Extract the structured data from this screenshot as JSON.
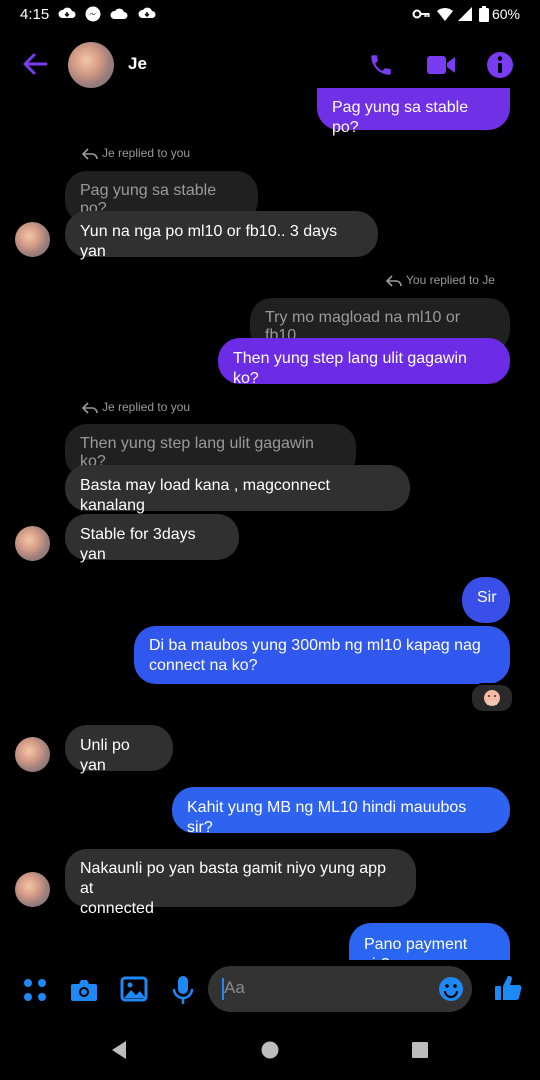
{
  "status_bar": {
    "time": "4:15",
    "battery": "60%"
  },
  "header": {
    "contact_name": "Je"
  },
  "messages": {
    "m1": "Pag yung sa stable po?",
    "reply1_label": "Je replied to you",
    "reply1_quote": "Pag yung sa stable po?",
    "m2": "Yun na nga po ml10 or fb10.. 3 days yan",
    "reply2_label": "You replied to Je",
    "reply2_quote": "Try mo magload na ml10 or fb10",
    "m3": "Then yung step lang ulit gagawin ko?",
    "reply3_label": "Je replied to you",
    "reply3_quote": "Then yung step lang ulit gagawin ko?",
    "m4": "Basta may load kana , magconnect kanalang",
    "m5": "Stable for 3days yan",
    "m6": "Sir",
    "m7_line1": "Di ba maubos yung 300mb ng ml10 kapag nag",
    "m7_line2": "connect na ko?",
    "m8": "Unli po yan",
    "m9": "Kahit yung MB ng ML10 hindi mauubos sir?",
    "m10_line1": "Nakaunli po yan basta gamit niyo yung app at",
    "m10_line2": "connected",
    "m11": "Pano payment sir?"
  },
  "compose": {
    "placeholder": "Aa"
  },
  "colors": {
    "accent": "#7a3cf0",
    "sent_purple": "#6c2ce6",
    "sent_blue": "#2f5ef0",
    "icon_blue": "#1e88f5"
  }
}
